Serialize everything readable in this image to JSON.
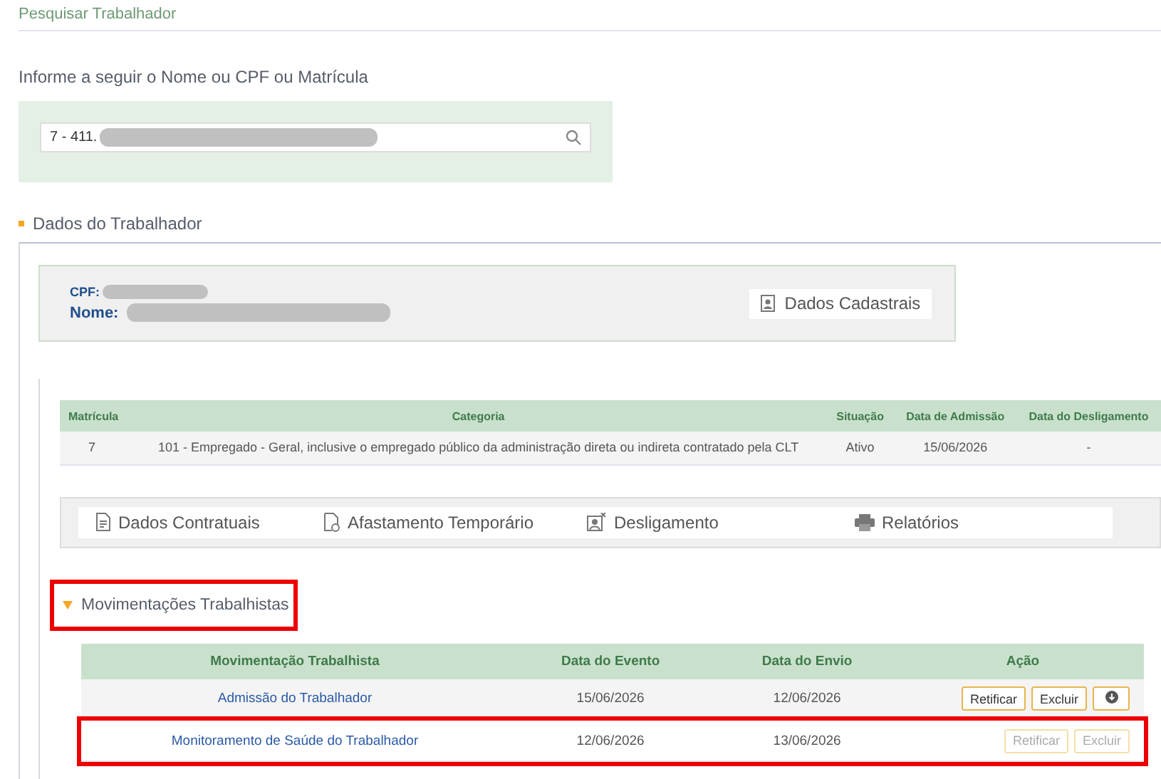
{
  "page_title": "Pesquisar Trabalhador",
  "search": {
    "label": "Informe a seguir o Nome ou CPF ou Matrícula",
    "value": "7 - 411.",
    "redacted": true
  },
  "worker_section": {
    "title": "Dados do Trabalhador",
    "card": {
      "cpf_label": "CPF:",
      "name_label": "Nome:",
      "redacted": true,
      "button": "Dados Cadastrais"
    },
    "table": {
      "columns": [
        "Matrícula",
        "Categoria",
        "Situação",
        "Data de Admissão",
        "Data do Desligamento"
      ],
      "rows": [
        [
          "7",
          "101 - Empregado - Geral, inclusive o empregado público da administração direta ou indireta contratado pela CLT",
          "Ativo",
          "15/06/2026",
          "-"
        ]
      ]
    },
    "actions": [
      {
        "label": "Dados Contratuais",
        "kind": "document"
      },
      {
        "label": "Afastamento Temporário",
        "kind": "leave"
      },
      {
        "label": "Desligamento",
        "kind": "dismiss"
      },
      {
        "label": "Relatórios",
        "kind": "print"
      }
    ]
  },
  "movements": {
    "title": "Movimentações Trabalhistas",
    "expanded": true,
    "highlighted": true,
    "columns": [
      "Movimentação Trabalhista",
      "Data do Evento",
      "Data do Envio",
      "Ação"
    ],
    "rows": [
      {
        "name": "Admissão do Trabalhador",
        "event_date": "15/06/2026",
        "sent_date": "12/06/2026",
        "highlighted": false,
        "buttons": [
          {
            "label": "Retificar",
            "disabled": false
          },
          {
            "label": "Excluir",
            "disabled": false
          }
        ],
        "download": true
      },
      {
        "name": "Monitoramento de Saúde do Trabalhador",
        "event_date": "12/06/2026",
        "sent_date": "13/06/2026",
        "highlighted": true,
        "buttons": [
          {
            "label": "Retificar",
            "disabled": true
          },
          {
            "label": "Excluir",
            "disabled": true
          }
        ],
        "download": false
      }
    ]
  }
}
